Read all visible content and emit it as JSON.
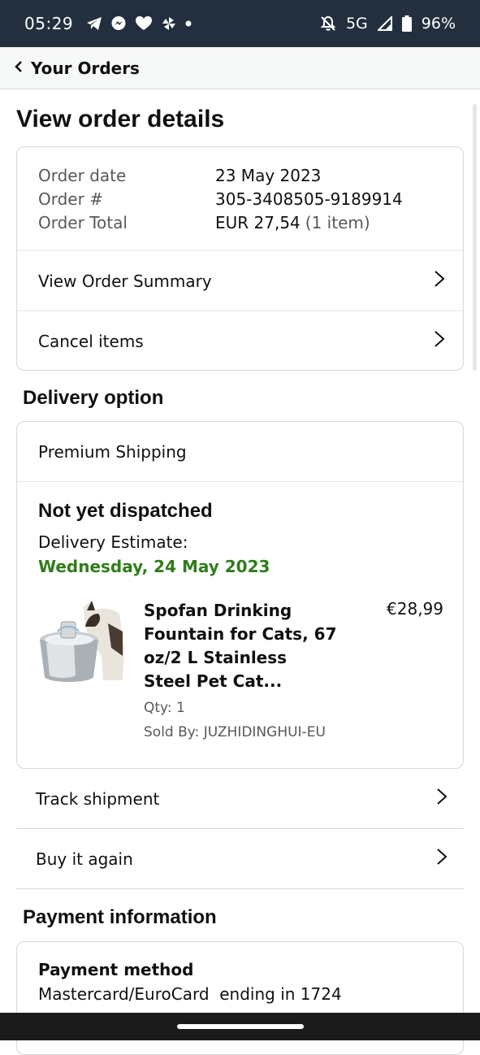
{
  "status_bar": {
    "time": "05:29",
    "network": "5G",
    "battery": "96%",
    "left_icons": [
      "telegram-icon",
      "messenger-icon",
      "health-icon",
      "pinwheel-icon",
      "dot-icon"
    ],
    "right_icons": [
      "bell-off-icon",
      "signal-icon",
      "battery-icon"
    ]
  },
  "nav": {
    "back_label": "Your Orders"
  },
  "page": {
    "title": "View order details"
  },
  "order": {
    "date_label": "Order date",
    "date_value": "23 May 2023",
    "number_label": "Order #",
    "number_value": "305-3408505-9189914",
    "total_label": "Order Total",
    "total_value": "EUR 27,54",
    "total_items": "(1 item)",
    "view_summary_label": "View Order Summary",
    "cancel_items_label": "Cancel items"
  },
  "delivery": {
    "section_title": "Delivery option",
    "shipping_option": "Premium Shipping",
    "status": "Not yet dispatched",
    "estimate_label": "Delivery Estimate:",
    "estimate_date": "Wednesday, 24 May 2023",
    "estimate_color": "#2f7d1a",
    "item": {
      "title": "Spofan Drinking Fountain for Cats, 67 oz/2 L Stainless Steel Pet Cat...",
      "qty": "Qty: 1",
      "sold_by": "Sold By: JUZHIDINGHUI-EU",
      "price": "€28,99"
    },
    "track_label": "Track shipment",
    "buy_again_label": "Buy it again"
  },
  "payment": {
    "section_title": "Payment information",
    "method_label": "Payment method",
    "method_value": "Mastercard/EuroCard  ending in 1724"
  },
  "colors": {
    "status_bar_bg": "#232f3e",
    "accent_green": "#2f7d1a"
  }
}
